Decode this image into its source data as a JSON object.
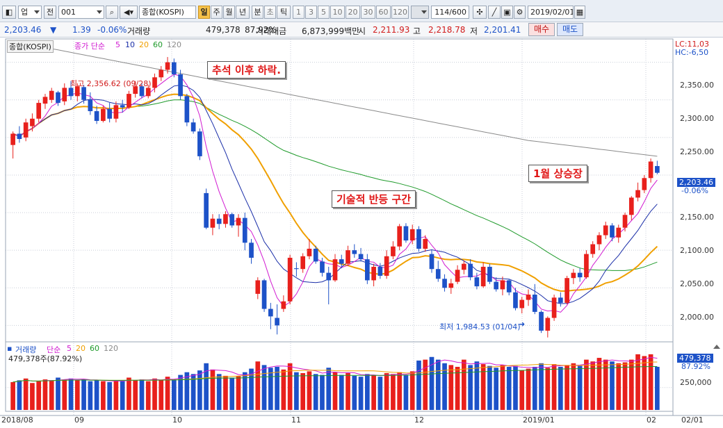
{
  "toolbar": {
    "mode": "업",
    "kind": "전",
    "code": "001",
    "name": "종합(KOSPI)",
    "periods": [
      "일",
      "주",
      "월",
      "년"
    ],
    "active_period": "일",
    "sub_periods": [
      "분",
      "초",
      "틱"
    ],
    "intervals": [
      "1",
      "3",
      "5",
      "10",
      "20",
      "30",
      "60",
      "120"
    ],
    "count": "114/600",
    "date": "2019/02/01"
  },
  "quote": {
    "price": "2,203.46",
    "direction": "▼",
    "change": "1.39",
    "change_pct": "-0.06%",
    "volume_label": "거래량",
    "volume": "479,378",
    "volume_pct": "87.92%",
    "amount_label": "거래대금",
    "amount": "6,873,999백만",
    "open_label": "시",
    "open": "2,211.93",
    "high_label": "고",
    "high": "2,218.78",
    "low_label": "저",
    "low": "2,201.41",
    "buy_label": "매수",
    "sell_label": "매도"
  },
  "price_panel": {
    "title": "종합(KOSPI)",
    "ma_label": "종가 단순",
    "ma_periods": [
      "5",
      "10",
      "20",
      "60",
      "120"
    ],
    "lc": "LC:11,03",
    "hc": "HC:-6,50",
    "last_price_tag": "2,203.46",
    "last_change_tag": "-0.06%",
    "high_note": "최고 2,356.62 (09/28)",
    "low_note": "최저 1,984.53 (01/04)",
    "y_ticks": [
      "2,350.00",
      "2,300.00",
      "2,250.00",
      "2,200.00",
      "2,150.00",
      "2,100.00",
      "2,050.00",
      "2,000.00"
    ],
    "annotations": [
      "추석 이후 하락.",
      "기술적 반등 구간",
      "1월 상승장"
    ]
  },
  "volume_panel": {
    "title": "거래량",
    "ma_label": "단순",
    "ma_periods": [
      "5",
      "20",
      "60",
      "120"
    ],
    "current": "479,378주(87.92%)",
    "tag_value": "479,378",
    "tag_pct": "87.92%",
    "y_tick": "250,000"
  },
  "x_labels": [
    "2018/08",
    "09",
    "10",
    "11",
    "12",
    "2019/01",
    "02",
    "02/01"
  ],
  "colors": {
    "up": "#e8201c",
    "down": "#1d52c8",
    "ma5": "#d11ad1",
    "ma10": "#1a2ea8",
    "ma20": "#f0a000",
    "ma60": "#1e9a2a",
    "ma120": "#8a8a8a"
  },
  "chart_data": {
    "type": "candlestick",
    "y_range": [
      1980,
      2370
    ],
    "volume_range": [
      0,
      650000
    ],
    "candles": [
      [
        2240,
        2258,
        2222,
        2255,
        310000
      ],
      [
        2255,
        2265,
        2243,
        2248,
        330000
      ],
      [
        2250,
        2275,
        2245,
        2270,
        350000
      ],
      [
        2265,
        2282,
        2258,
        2275,
        300000
      ],
      [
        2275,
        2300,
        2270,
        2296,
        320000
      ],
      [
        2295,
        2308,
        2288,
        2304,
        340000
      ],
      [
        2300,
        2316,
        2296,
        2312,
        330000
      ],
      [
        2310,
        2312,
        2292,
        2296,
        360000
      ],
      [
        2298,
        2322,
        2293,
        2316,
        340000
      ],
      [
        2316,
        2325,
        2300,
        2305,
        350000
      ],
      [
        2305,
        2322,
        2298,
        2318,
        330000
      ],
      [
        2317,
        2320,
        2295,
        2300,
        340000
      ],
      [
        2300,
        2310,
        2280,
        2285,
        320000
      ],
      [
        2285,
        2292,
        2268,
        2272,
        330000
      ],
      [
        2272,
        2292,
        2270,
        2288,
        320000
      ],
      [
        2288,
        2296,
        2270,
        2275,
        310000
      ],
      [
        2275,
        2298,
        2270,
        2293,
        330000
      ],
      [
        2293,
        2300,
        2283,
        2290,
        320000
      ],
      [
        2290,
        2312,
        2288,
        2308,
        360000
      ],
      [
        2308,
        2325,
        2303,
        2318,
        330000
      ],
      [
        2318,
        2322,
        2302,
        2305,
        340000
      ],
      [
        2305,
        2320,
        2302,
        2316,
        320000
      ],
      [
        2316,
        2335,
        2310,
        2330,
        350000
      ],
      [
        2330,
        2345,
        2325,
        2340,
        330000
      ],
      [
        2340,
        2357,
        2335,
        2350,
        370000
      ],
      [
        2350,
        2355,
        2330,
        2334,
        340000
      ],
      [
        2334,
        2340,
        2300,
        2305,
        390000
      ],
      [
        2305,
        2308,
        2265,
        2270,
        420000
      ],
      [
        2270,
        2275,
        2255,
        2258,
        400000
      ],
      [
        2258,
        2262,
        2220,
        2225,
        440000
      ],
      [
        2176,
        2182,
        2128,
        2130,
        520000
      ],
      [
        2130,
        2148,
        2120,
        2142,
        450000
      ],
      [
        2142,
        2148,
        2128,
        2135,
        400000
      ],
      [
        2135,
        2152,
        2130,
        2148,
        380000
      ],
      [
        2148,
        2150,
        2130,
        2133,
        360000
      ],
      [
        2133,
        2148,
        2118,
        2143,
        380000
      ],
      [
        2143,
        2150,
        2100,
        2110,
        420000
      ],
      [
        2110,
        2115,
        2082,
        2090,
        460000
      ],
      [
        2042,
        2064,
        2035,
        2060,
        540000
      ],
      [
        2060,
        2062,
        2018,
        2022,
        500000
      ],
      [
        2022,
        2030,
        1995,
        2012,
        470000
      ],
      [
        2010,
        2028,
        1988,
        2000,
        480000
      ],
      [
        2022,
        2040,
        2018,
        2032,
        450000
      ],
      [
        2032,
        2094,
        2028,
        2090,
        520000
      ],
      [
        2076,
        2084,
        2065,
        2075,
        420000
      ],
      [
        2075,
        2096,
        2070,
        2092,
        410000
      ],
      [
        2092,
        2115,
        2088,
        2102,
        430000
      ],
      [
        2102,
        2106,
        2082,
        2085,
        400000
      ],
      [
        2085,
        2090,
        2065,
        2070,
        390000
      ],
      [
        2070,
        2078,
        2028,
        2060,
        470000
      ],
      [
        2060,
        2095,
        2058,
        2088,
        420000
      ],
      [
        2088,
        2094,
        2076,
        2082,
        390000
      ],
      [
        2082,
        2106,
        2079,
        2100,
        410000
      ],
      [
        2100,
        2108,
        2090,
        2095,
        380000
      ],
      [
        2095,
        2103,
        2085,
        2088,
        370000
      ],
      [
        2088,
        2095,
        2055,
        2060,
        400000
      ],
      [
        2060,
        2082,
        2052,
        2078,
        390000
      ],
      [
        2078,
        2083,
        2062,
        2066,
        370000
      ],
      [
        2066,
        2100,
        2062,
        2092,
        410000
      ],
      [
        2092,
        2112,
        2088,
        2105,
        400000
      ],
      [
        2105,
        2135,
        2100,
        2132,
        420000
      ],
      [
        2132,
        2136,
        2110,
        2113,
        390000
      ],
      [
        2113,
        2134,
        2108,
        2128,
        430000
      ],
      [
        2128,
        2132,
        2098,
        2102,
        550000
      ],
      [
        2102,
        2120,
        2098,
        2115,
        560000
      ],
      [
        2095,
        2100,
        2070,
        2075,
        590000
      ],
      [
        2075,
        2086,
        2058,
        2062,
        560000
      ],
      [
        2062,
        2068,
        2045,
        2050,
        520000
      ],
      [
        2050,
        2062,
        2042,
        2056,
        500000
      ],
      [
        2058,
        2080,
        2055,
        2074,
        480000
      ],
      [
        2074,
        2086,
        2068,
        2082,
        560000
      ],
      [
        2082,
        2088,
        2060,
        2064,
        500000
      ],
      [
        2064,
        2070,
        2048,
        2052,
        540000
      ],
      [
        2052,
        2084,
        2050,
        2078,
        510000
      ],
      [
        2078,
        2082,
        2055,
        2058,
        490000
      ],
      [
        2058,
        2064,
        2045,
        2048,
        470000
      ],
      [
        2048,
        2065,
        2040,
        2060,
        500000
      ],
      [
        2060,
        2062,
        2040,
        2044,
        480000
      ],
      [
        2044,
        2050,
        2020,
        2023,
        490000
      ],
      [
        2023,
        2038,
        2016,
        2034,
        440000
      ],
      [
        2034,
        2048,
        2026,
        2041,
        460000
      ],
      [
        2041,
        2055,
        2015,
        2018,
        480000
      ],
      [
        2018,
        2020,
        1990,
        1993,
        520000
      ],
      [
        1993,
        2012,
        1984,
        2010,
        470000
      ],
      [
        2010,
        2041,
        2006,
        2037,
        510000
      ],
      [
        2037,
        2044,
        2025,
        2030,
        480000
      ],
      [
        2030,
        2066,
        2028,
        2063,
        500000
      ],
      [
        2063,
        2075,
        2055,
        2070,
        520000
      ],
      [
        2070,
        2076,
        2058,
        2064,
        490000
      ],
      [
        2064,
        2100,
        2062,
        2095,
        560000
      ],
      [
        2095,
        2112,
        2090,
        2108,
        540000
      ],
      [
        2108,
        2124,
        2100,
        2120,
        580000
      ],
      [
        2120,
        2138,
        2115,
        2133,
        560000
      ],
      [
        2133,
        2136,
        2112,
        2117,
        540000
      ],
      [
        2117,
        2134,
        2110,
        2130,
        520000
      ],
      [
        2130,
        2150,
        2125,
        2147,
        530000
      ],
      [
        2147,
        2172,
        2140,
        2170,
        560000
      ],
      [
        2170,
        2190,
        2165,
        2180,
        620000
      ],
      [
        2180,
        2200,
        2176,
        2196,
        600000
      ],
      [
        2196,
        2222,
        2190,
        2218,
        620000
      ],
      [
        2212,
        2219,
        2201,
        2203,
        480000
      ]
    ]
  }
}
